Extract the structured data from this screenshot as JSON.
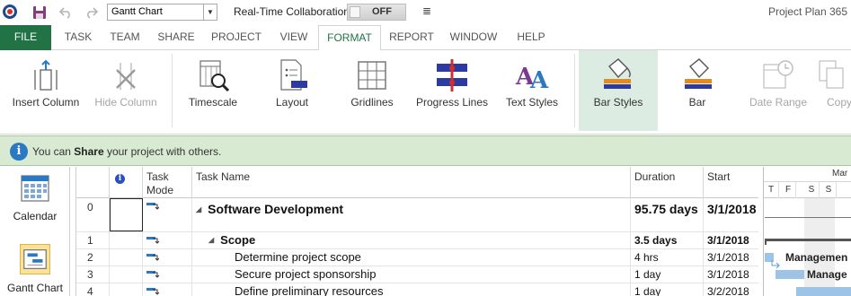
{
  "quick_access": {
    "view_select_value": "Gantt Chart",
    "collab_label": "Real-Time Collaboration",
    "collab_state": "OFF",
    "more_glyph": "≣"
  },
  "app_title": "Project Plan 365",
  "tabs": [
    {
      "label": "FILE"
    },
    {
      "label": "TASK"
    },
    {
      "label": "TEAM"
    },
    {
      "label": "SHARE"
    },
    {
      "label": "PROJECT"
    },
    {
      "label": "VIEW"
    },
    {
      "label": "FORMAT",
      "active": true
    },
    {
      "label": "REPORT"
    },
    {
      "label": "WINDOW"
    },
    {
      "label": "HELP"
    }
  ],
  "ribbon": {
    "insert_column": "Insert Column",
    "hide_column": "Hide Column",
    "timescale": "Timescale",
    "layout": "Layout",
    "gridlines": "Gridlines",
    "progress_lines": "Progress Lines",
    "text_styles": "Text Styles",
    "bar_styles": "Bar Styles",
    "bar": "Bar",
    "date_range": "Date Range",
    "copy": "Copy"
  },
  "infobar": {
    "prefix": "You can ",
    "bold": "Share",
    "suffix": " your project with others."
  },
  "viewbar": {
    "calendar": "Calendar",
    "gantt": "Gantt Chart"
  },
  "grid": {
    "headers": {
      "info": "i",
      "mode": "Task Mode",
      "name": "Task Name",
      "duration": "Duration",
      "start": "Start"
    },
    "rows": [
      {
        "id": "0",
        "name": "Software Development",
        "duration": "95.75 days",
        "start": "3/1/2018"
      },
      {
        "id": "1",
        "name": "Scope",
        "duration": "3.5 days",
        "start": "3/1/2018"
      },
      {
        "id": "2",
        "name": "Determine project scope",
        "duration": "4 hrs",
        "start": "3/1/2018"
      },
      {
        "id": "3",
        "name": "Secure project sponsorship",
        "duration": "1 day",
        "start": "3/1/2018"
      },
      {
        "id": "4",
        "name": "Define preliminary resources",
        "duration": "1 day",
        "start": "3/2/2018"
      }
    ]
  },
  "gantt": {
    "month": "Mar",
    "days": [
      "T",
      "F",
      "S",
      "S"
    ],
    "labels": [
      "Managemen",
      "Manage"
    ]
  },
  "colors": {
    "accent": "#217346",
    "infobar": "#d9ead3",
    "gantt_bar": "#9dc3e6"
  }
}
